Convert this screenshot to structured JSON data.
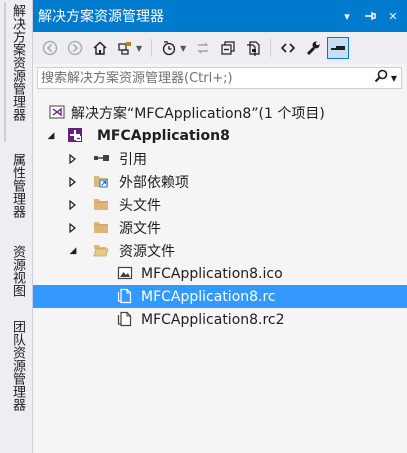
{
  "left_tabs": [
    "解决方案资源管理器",
    "属性管理器",
    "资源视图",
    "团队资源管理器"
  ],
  "panel": {
    "title": "解决方案资源管理器",
    "controls": {
      "dropdown": "▾",
      "pin": "⊣",
      "close": "✕"
    }
  },
  "search": {
    "placeholder": "搜索解决方案资源管理器(Ctrl+;)"
  },
  "tree": {
    "solution": "解决方案“MFCApplication8”(1 个项目)",
    "project": "MFCApplication8",
    "references": "引用",
    "external_deps": "外部依赖项",
    "header_files": "头文件",
    "source_files": "源文件",
    "resource_files": "资源文件",
    "file_ico": "MFCApplication8.ico",
    "file_rc": "MFCApplication8.rc",
    "file_rc2": "MFCApplication8.rc2"
  },
  "colors": {
    "accent": "#007ACC",
    "selection": "#3399FF"
  }
}
